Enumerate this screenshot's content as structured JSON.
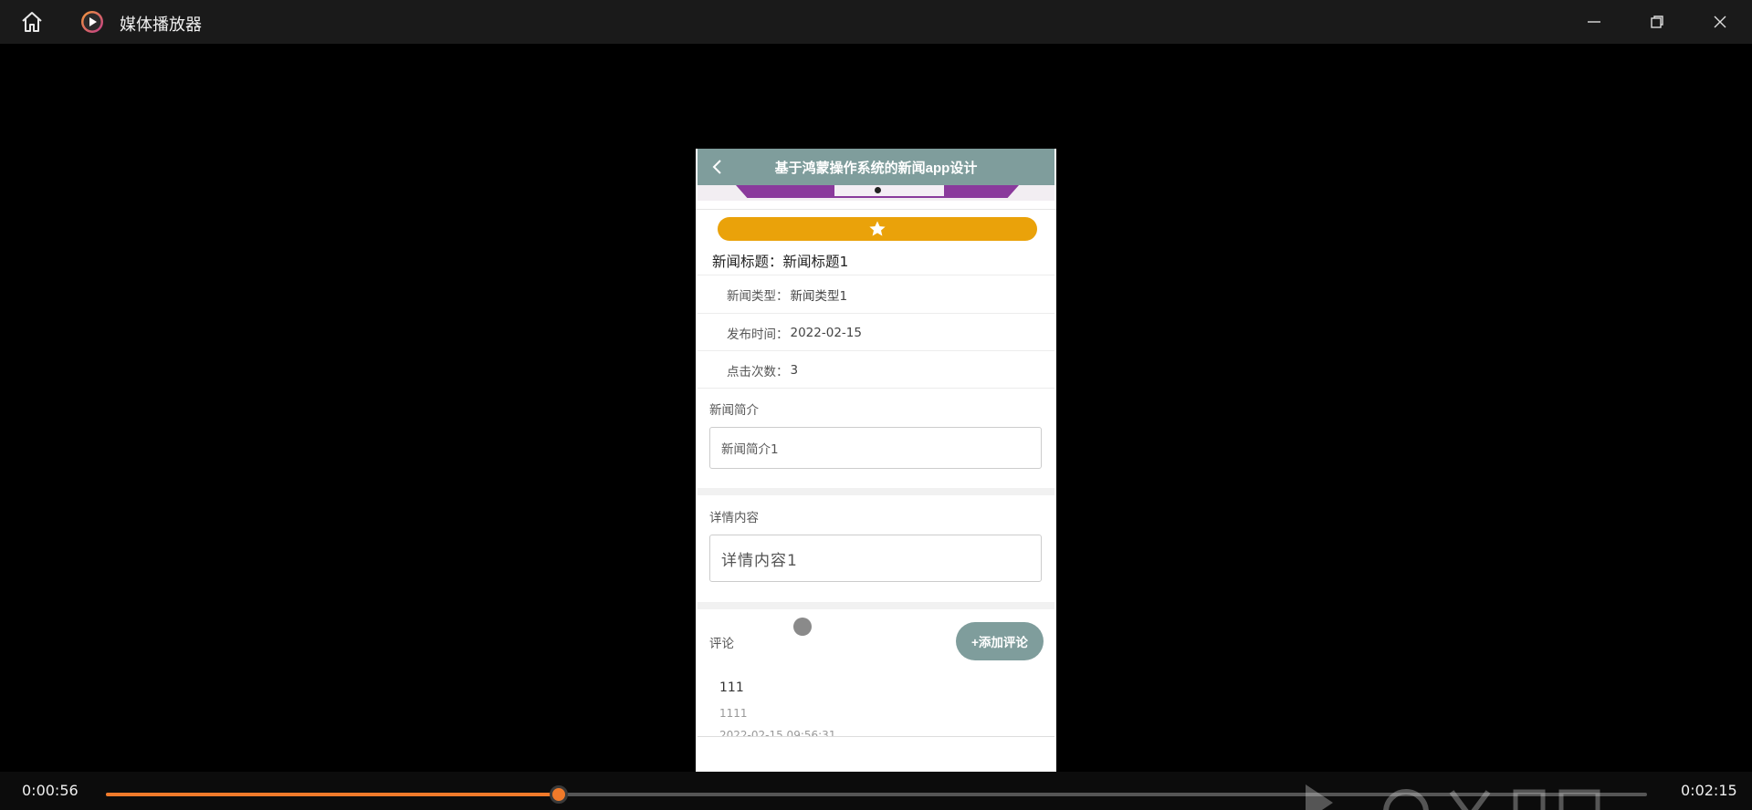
{
  "window": {
    "title": "媒体播放器"
  },
  "app": {
    "header_title": "基于鸿蒙操作系统的新闻app设计",
    "news_title_label": "新闻标题：",
    "news_title_value": "新闻标题1",
    "info_rows": [
      {
        "label": "新闻类型：",
        "value": "新闻类型1"
      },
      {
        "label": "发布时间：",
        "value": "2022-02-15"
      },
      {
        "label": "点击次数：",
        "value": "3"
      }
    ],
    "intro_label": "新闻简介",
    "intro_value": "新闻简介1",
    "detail_label": "详情内容",
    "detail_value": "详情内容1",
    "comments_label": "评论",
    "add_comment_label": "+添加评论",
    "comment": {
      "user": "111",
      "text": "1111",
      "time": "2022-02-15 09:56:31"
    }
  },
  "player": {
    "current_time": "0:00:56",
    "total_time": "0:02:15",
    "progress": 0.294,
    "accent_color": "#f07a2a"
  },
  "colors": {
    "header_bg": "#7f9d9c",
    "favorite_bar": "#eaa20a"
  },
  "icons": [
    "home-icon",
    "media-player-logo-icon",
    "minimize-icon",
    "maximize-icon",
    "close-icon",
    "back-arrow-icon",
    "star-icon"
  ]
}
